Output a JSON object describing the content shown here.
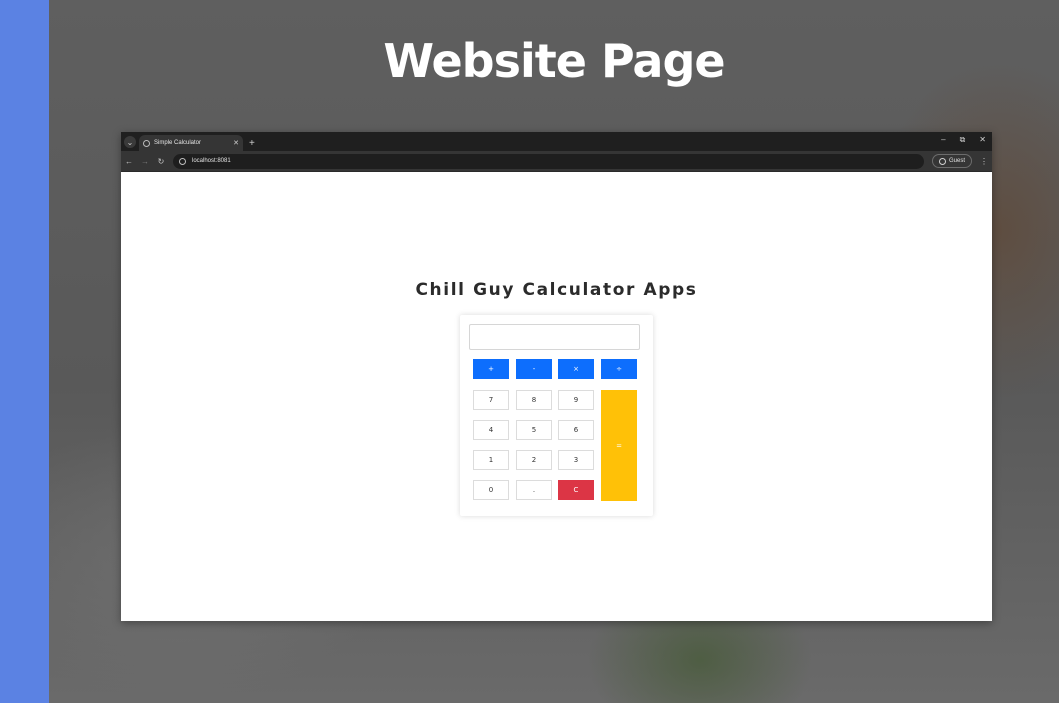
{
  "slide": {
    "title": "Website Page",
    "accent_color": "#5b82e3"
  },
  "browser": {
    "tab": {
      "title": "Simple Calculator",
      "close_icon": "close-icon",
      "new_tab_icon": "plus-icon"
    },
    "window_controls": {
      "minimize": "–",
      "restore": "⧉",
      "close": "✕"
    },
    "toolbar": {
      "url": "localhost:8081",
      "profile_label": "Guest"
    }
  },
  "app": {
    "title": "Chill Guy Calculator Apps",
    "display_value": "",
    "operators": [
      "+",
      "-",
      "×",
      "÷"
    ],
    "digits_row1": [
      "7",
      "8",
      "9"
    ],
    "digits_row2": [
      "4",
      "5",
      "6"
    ],
    "digits_row3": [
      "1",
      "2",
      "3"
    ],
    "bottom_row": [
      "0",
      "."
    ],
    "clear_label": "C",
    "equals_label": "=",
    "colors": {
      "operator": "#0d6efd",
      "clear": "#dc3545",
      "equals": "#ffc107"
    }
  }
}
